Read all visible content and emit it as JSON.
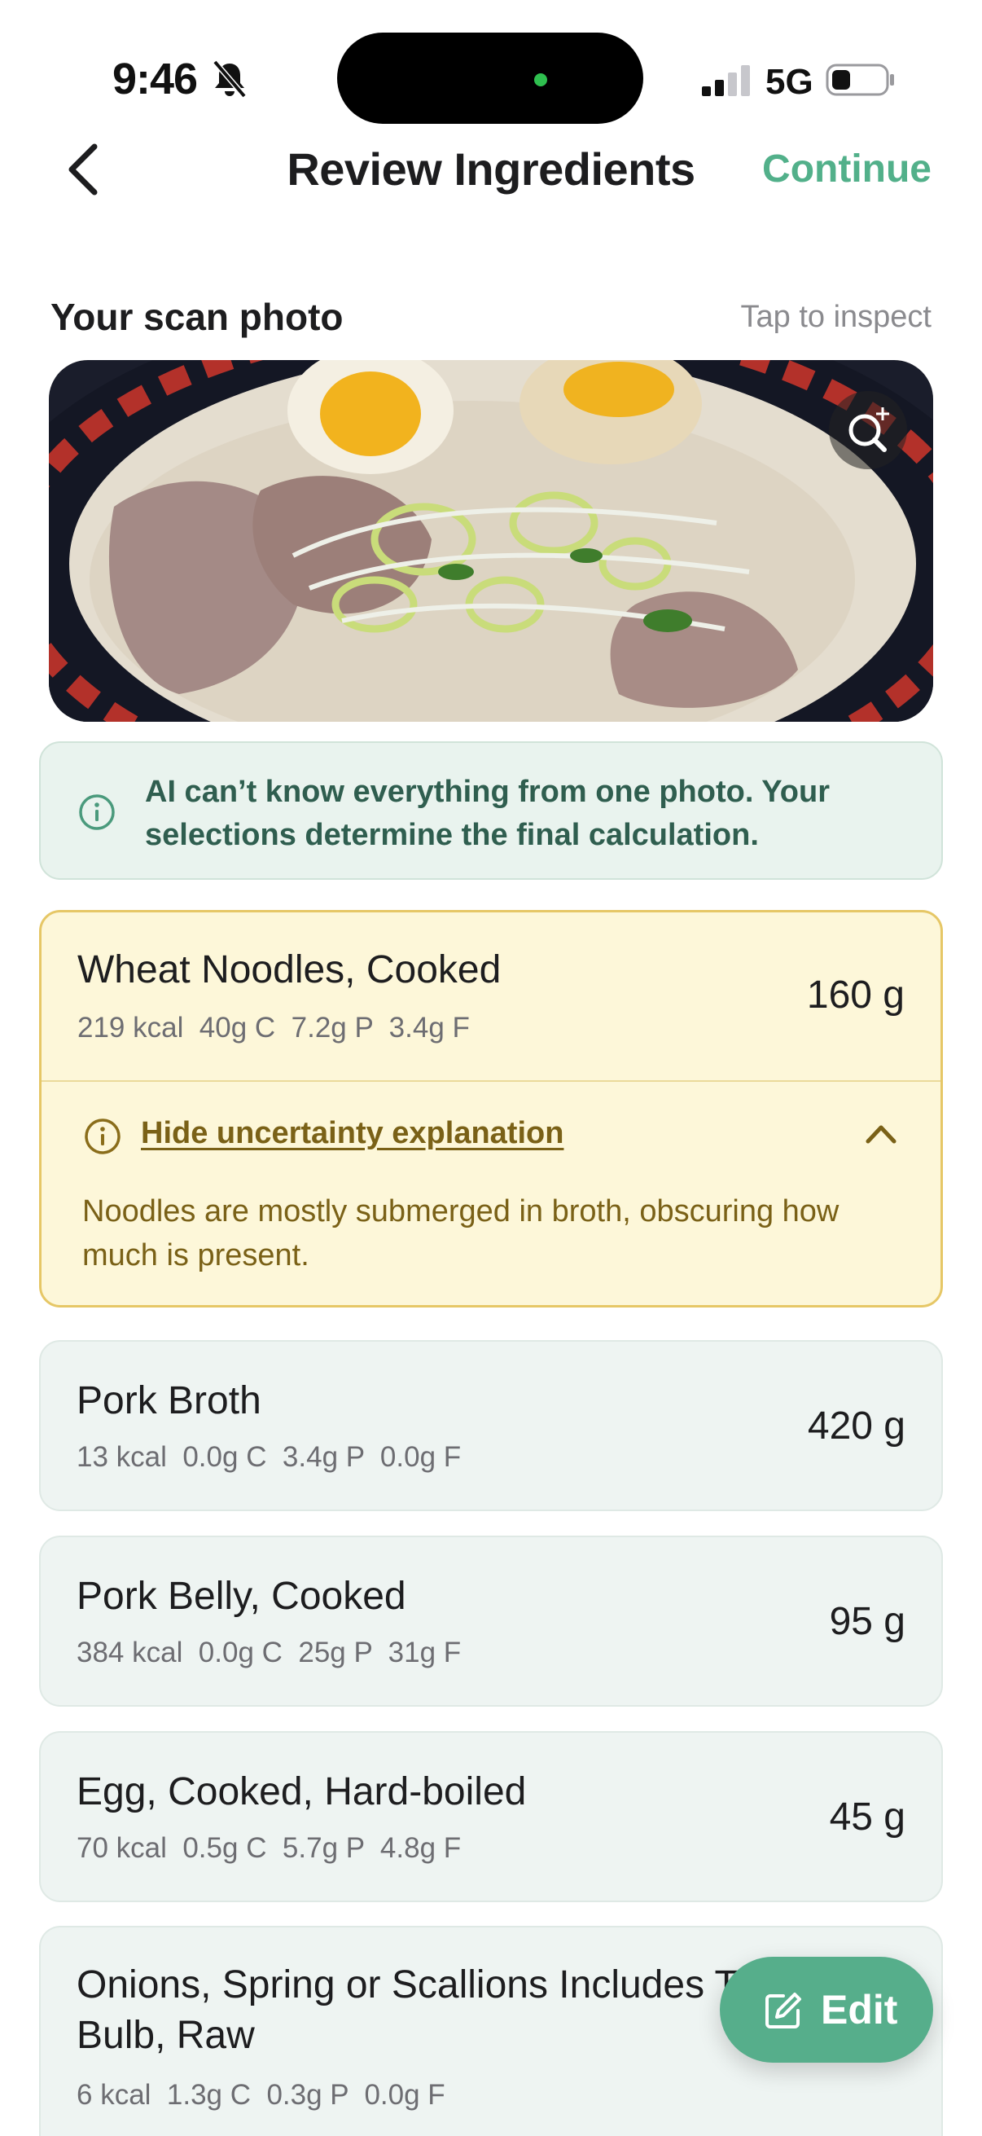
{
  "status_bar": {
    "time": "9:46",
    "network": "5G",
    "icons": [
      "bell-slash-icon",
      "signal-icon",
      "battery-icon"
    ]
  },
  "nav": {
    "title": "Review Ingredients",
    "continue_label": "Continue",
    "back_icon": "chevron-left-icon"
  },
  "scan": {
    "label": "Your scan photo",
    "hint": "Tap to inspect",
    "zoom_icon": "zoom-in-icon"
  },
  "info_banner": {
    "text": "AI can’t know everything from one photo. Your selections determine the final calculation."
  },
  "ingredients": [
    {
      "name": "Wheat Noodles, Cooked",
      "macros": "219 kcal  40g C  7.2g P  3.4g F",
      "weight": "160 g",
      "uncertainty": {
        "toggle_label": "Hide uncertainty explanation",
        "text": "Noodles are mostly submerged in broth, obscuring how much is present."
      }
    },
    {
      "name": "Pork Broth",
      "macros": "13 kcal  0.0g C  3.4g P  0.0g F",
      "weight": "420 g"
    },
    {
      "name": "Pork Belly, Cooked",
      "macros": "384 kcal  0.0g C  25g P  31g F",
      "weight": "95 g"
    },
    {
      "name": "Egg, Cooked, Hard-boiled",
      "macros": "70 kcal  0.5g C  5.7g P  4.8g F",
      "weight": "45 g"
    },
    {
      "name": "Onions, Spring or Scallions Includes Tops and Bulb, Raw",
      "macros": "6 kcal  1.3g C  0.3g P  0.0g F",
      "weight": ""
    }
  ],
  "edit_button": {
    "label": "Edit",
    "icon": "edit-icon"
  },
  "colors": {
    "accent": "#56ae8b",
    "banner_bg": "#e9f3ee",
    "warning_bg": "#fdf7d9",
    "warning_border": "#e6c766",
    "card_bg": "#eef4f2"
  }
}
